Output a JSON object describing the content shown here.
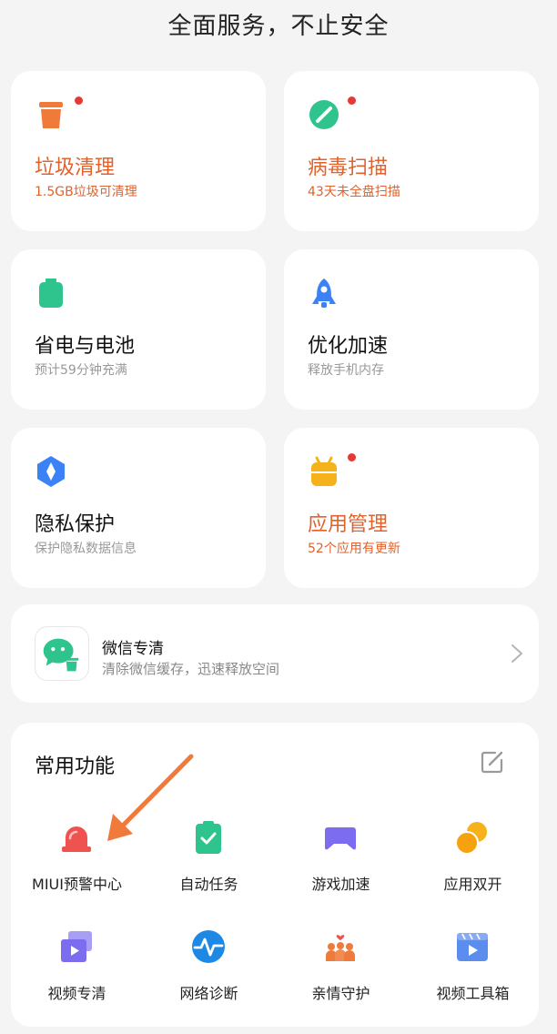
{
  "header": {
    "title": "全面服务，不止安全"
  },
  "features": [
    {
      "title": "垃圾清理",
      "subtitle": "1.5GB垃圾可清理",
      "icon": "trash-can-icon"
    },
    {
      "title": "病毒扫描",
      "subtitle": "43天未全盘扫描",
      "icon": "virus-scan-icon"
    },
    {
      "title": "省电与电池",
      "subtitle": "预计59分钟充满",
      "icon": "battery-icon"
    },
    {
      "title": "优化加速",
      "subtitle": "释放手机内存",
      "icon": "rocket-icon"
    },
    {
      "title": "隐私保护",
      "subtitle": "保护隐私数据信息",
      "icon": "privacy-shield-icon"
    },
    {
      "title": "应用管理",
      "subtitle": "52个应用有更新",
      "icon": "android-app-icon"
    }
  ],
  "wechat": {
    "title": "微信专清",
    "subtitle": "清除微信缓存，迅速释放空间"
  },
  "common": {
    "title": "常用功能",
    "items": [
      {
        "label": "MIUI预警中心",
        "icon": "alarm-siren-icon"
      },
      {
        "label": "自动任务",
        "icon": "clipboard-check-icon"
      },
      {
        "label": "游戏加速",
        "icon": "gamepad-icon"
      },
      {
        "label": "应用双开",
        "icon": "dual-app-icon"
      },
      {
        "label": "视频专清",
        "icon": "video-clean-icon"
      },
      {
        "label": "网络诊断",
        "icon": "network-pulse-icon"
      },
      {
        "label": "亲情守护",
        "icon": "family-guard-icon"
      },
      {
        "label": "视频工具箱",
        "icon": "video-toolbox-icon"
      }
    ]
  },
  "colors": {
    "alert_text": "#e0622c",
    "orange": "#f07a3a",
    "green": "#2fc48d",
    "blue": "#3b82f6",
    "yellow": "#f6b21b",
    "red_dot": "#e53935",
    "purple": "#7b6cf0",
    "annotation_arrow": "#f07a3a"
  }
}
